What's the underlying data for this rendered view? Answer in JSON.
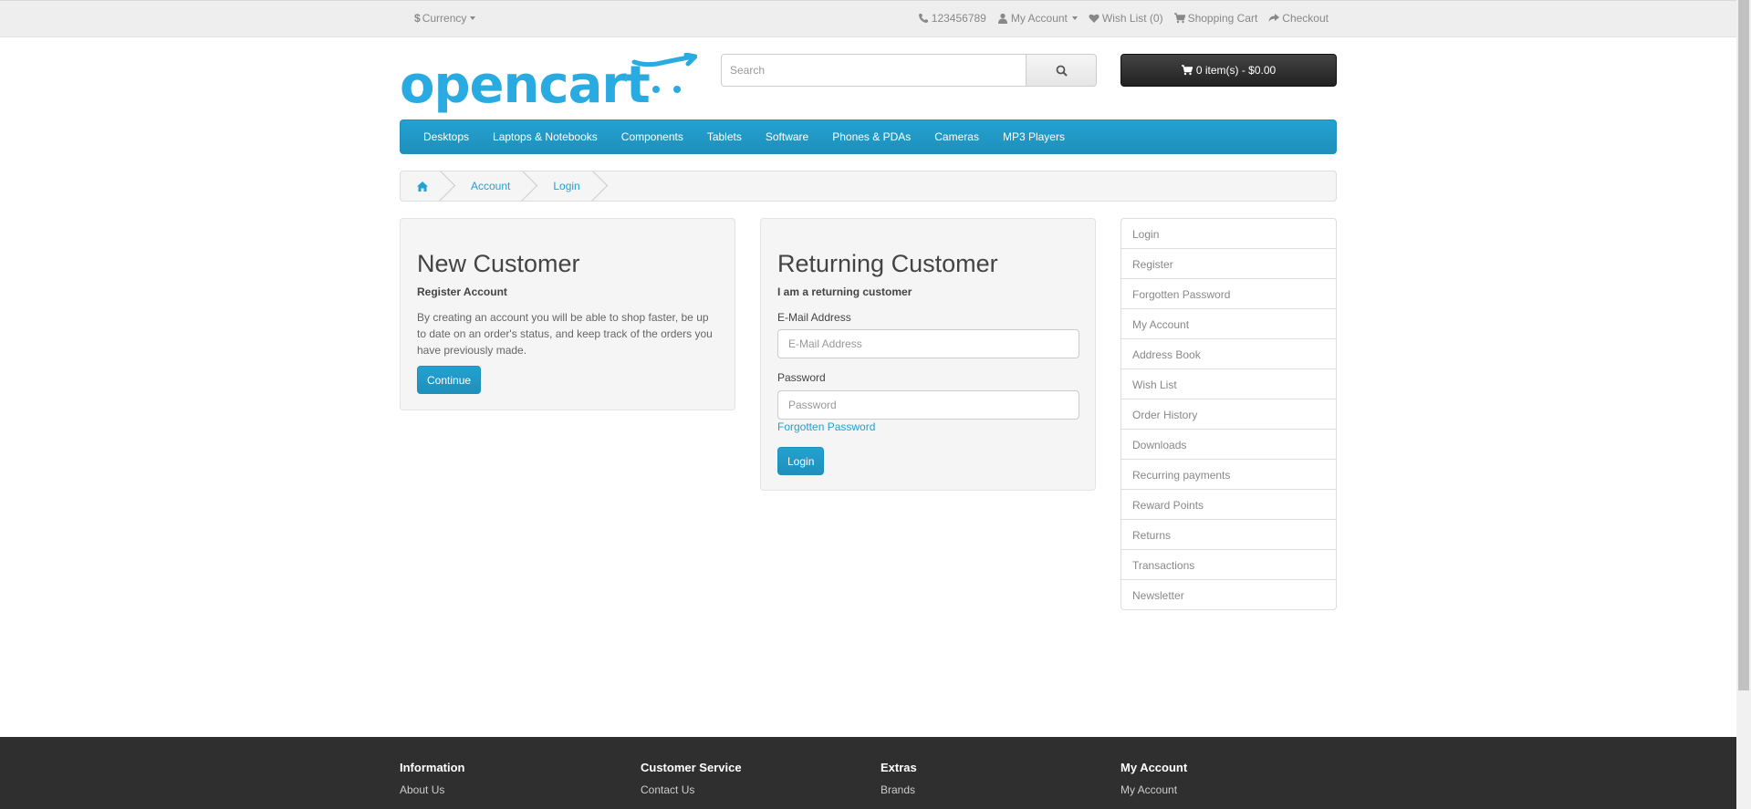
{
  "topbar": {
    "currency_symbol": "$",
    "currency_label": "Currency",
    "phone": "123456789",
    "my_account": "My Account",
    "wishlist": "Wish List (0)",
    "shopping_cart": "Shopping Cart",
    "checkout": "Checkout"
  },
  "header": {
    "logo_text": "opencart",
    "search_placeholder": "Search",
    "cart_label": "0 item(s) - $0.00"
  },
  "menu": [
    "Desktops",
    "Laptops & Notebooks",
    "Components",
    "Tablets",
    "Software",
    "Phones & PDAs",
    "Cameras",
    "MP3 Players"
  ],
  "breadcrumb": [
    "Account",
    "Login"
  ],
  "new_customer": {
    "title": "New Customer",
    "subtitle": "Register Account",
    "text": "By creating an account you will be able to shop faster, be up to date on an order's status, and keep track of the orders you have previously made.",
    "button": "Continue"
  },
  "returning_customer": {
    "title": "Returning Customer",
    "subtitle": "I am a returning customer",
    "email_label": "E-Mail Address",
    "email_placeholder": "E-Mail Address",
    "password_label": "Password",
    "password_placeholder": "Password",
    "forgot_link": "Forgotten Password",
    "button": "Login"
  },
  "account_list": [
    "Login",
    "Register",
    "Forgotten Password",
    "My Account",
    "Address Book",
    "Wish List",
    "Order History",
    "Downloads",
    "Recurring payments",
    "Reward Points",
    "Returns",
    "Transactions",
    "Newsletter"
  ],
  "footer": {
    "columns": [
      {
        "title": "Information",
        "link": "About Us"
      },
      {
        "title": "Customer Service",
        "link": "Contact Us"
      },
      {
        "title": "Extras",
        "link": "Brands"
      },
      {
        "title": "My Account",
        "link": "My Account"
      }
    ]
  },
  "colors": {
    "accent": "#23a1d1",
    "footer_bg": "#2f2f2f",
    "cart_bg": "#222222"
  }
}
